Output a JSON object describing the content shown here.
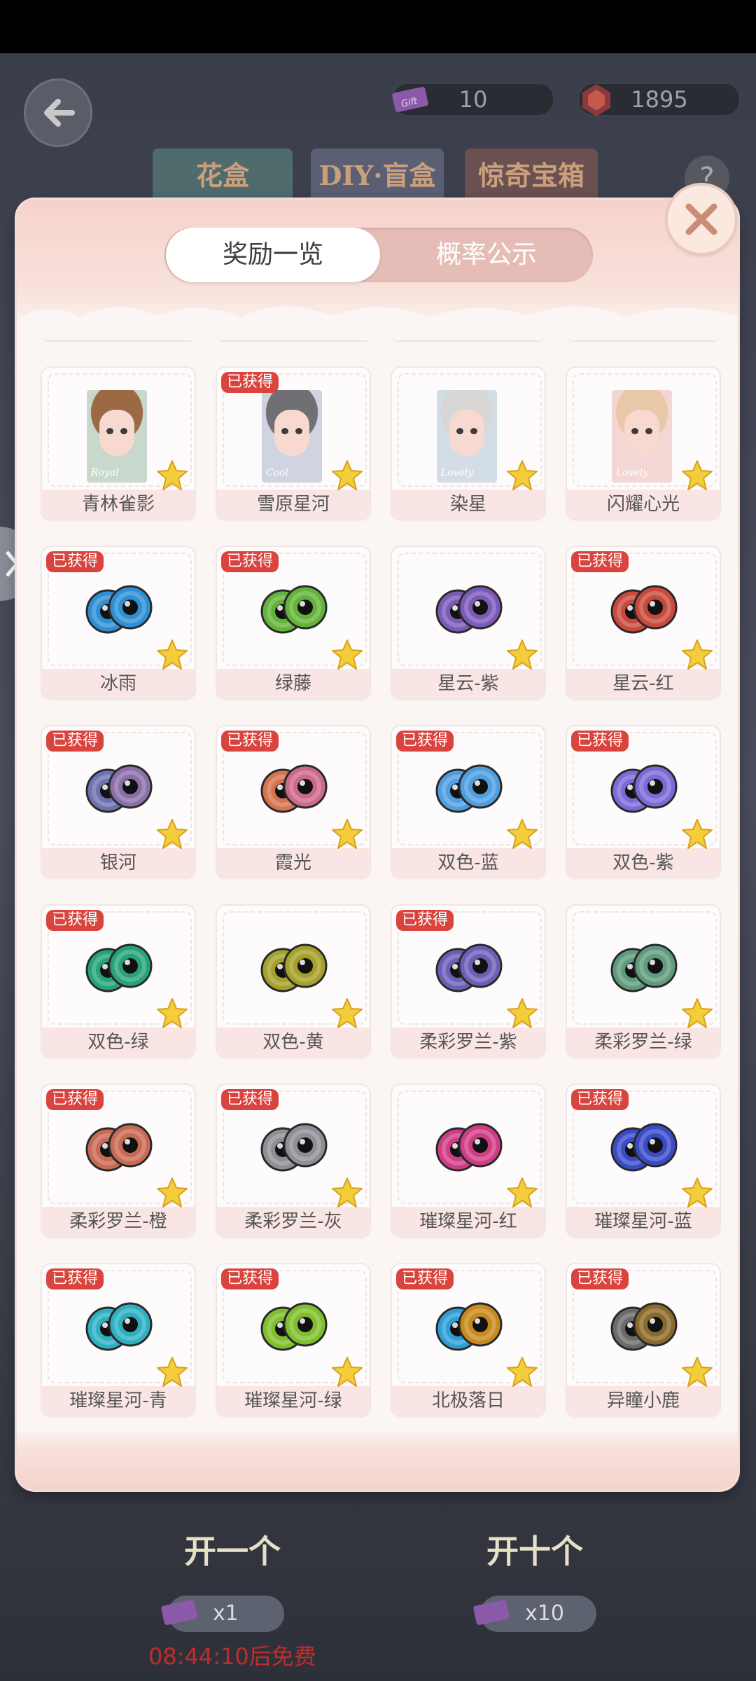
{
  "hud": {
    "ticket_count": "10",
    "gem_count": "1895",
    "top_tabs": [
      "花盒",
      "DIY·盲盒",
      "惊奇宝箱"
    ],
    "help": "?"
  },
  "modal": {
    "tabs": [
      {
        "label": "奖励一览",
        "active": true
      },
      {
        "label": "概率公示",
        "active": false
      }
    ],
    "items": [
      {
        "name": "青林雀影",
        "type": "portrait",
        "caption": "Royal",
        "obtained": false,
        "hair": "#9b6a45",
        "bg": "#c9d8cc"
      },
      {
        "name": "雪原星河",
        "type": "portrait",
        "caption": "Cool",
        "obtained": true,
        "hair": "#6f6f74",
        "bg": "#cfd4e0"
      },
      {
        "name": "染星",
        "type": "portrait",
        "caption": "Lovely",
        "obtained": false,
        "hair": "#d9d6d6",
        "bg": "#d3dde6"
      },
      {
        "name": "闪耀心光",
        "type": "portrait",
        "caption": "Lovely",
        "obtained": false,
        "hair": "#e8c8a8",
        "bg": "#f2d7d4"
      },
      {
        "name": "冰雨",
        "type": "eyes",
        "color": "#2e8fd4",
        "color2": "#2e8fd4",
        "obtained": true
      },
      {
        "name": "绿藤",
        "type": "eyes",
        "color": "#63b43a",
        "color2": "#63b43a",
        "obtained": true
      },
      {
        "name": "星云-紫",
        "type": "eyes",
        "color": "#7a5ab8",
        "color2": "#7a5ab8",
        "obtained": false
      },
      {
        "name": "星云-红",
        "type": "eyes",
        "color": "#c84a3c",
        "color2": "#c84a3c",
        "obtained": true
      },
      {
        "name": "银河",
        "type": "eyes",
        "color": "#6d72b0",
        "color2": "#8a6fa8",
        "obtained": true
      },
      {
        "name": "霞光",
        "type": "eyes",
        "color": "#d6744e",
        "color2": "#cc6a8a",
        "obtained": true
      },
      {
        "name": "双色-蓝",
        "type": "eyes",
        "color": "#4f9ee0",
        "color2": "#4f9ee0",
        "obtained": true
      },
      {
        "name": "双色-紫",
        "type": "eyes",
        "color": "#7d6ad8",
        "color2": "#7d6ad8",
        "obtained": true
      },
      {
        "name": "双色-绿",
        "type": "eyes",
        "color": "#27a37b",
        "color2": "#27a37b",
        "obtained": true
      },
      {
        "name": "双色-黄",
        "type": "eyes",
        "color": "#a5a12a",
        "color2": "#a5a12a",
        "obtained": false
      },
      {
        "name": "柔彩罗兰-紫",
        "type": "eyes",
        "color": "#6a5fb6",
        "color2": "#6a5fb6",
        "obtained": true
      },
      {
        "name": "柔彩罗兰-绿",
        "type": "eyes",
        "color": "#5f9c7e",
        "color2": "#5f9c7e",
        "obtained": false
      },
      {
        "name": "柔彩罗兰-橙",
        "type": "eyes",
        "color": "#c96a55",
        "color2": "#c96a55",
        "obtained": true
      },
      {
        "name": "柔彩罗兰-灰",
        "type": "eyes",
        "color": "#8e9096",
        "color2": "#8e9096",
        "obtained": true
      },
      {
        "name": "璀璨星河-红",
        "type": "eyes",
        "color": "#cf3d86",
        "color2": "#cf3d86",
        "obtained": false
      },
      {
        "name": "璀璨星河-蓝",
        "type": "eyes",
        "color": "#3a4bc8",
        "color2": "#3a4bc8",
        "obtained": true
      },
      {
        "name": "璀璨星河-青",
        "type": "eyes",
        "color": "#2eb0c2",
        "color2": "#2eb0c2",
        "obtained": true
      },
      {
        "name": "璀璨星河-绿",
        "type": "eyes",
        "color": "#7fbf2e",
        "color2": "#7fbf2e",
        "obtained": true
      },
      {
        "name": "北极落日",
        "type": "eyes",
        "color": "#2f9ed6",
        "color2": "#c78a1e",
        "obtained": true
      },
      {
        "name": "异瞳小鹿",
        "type": "eyes",
        "color": "#6b6b6b",
        "color2": "#8a6a2a",
        "obtained": true
      }
    ],
    "obtained_label": "已获得"
  },
  "bottom": {
    "open_one": "开一个",
    "open_ten": "开十个",
    "cost_one": "x1",
    "cost_ten": "x10",
    "timer": "08:44:10后免费"
  },
  "colors": {
    "badge": "#d9443e",
    "card_label_bg": "#f9e6e4",
    "tab_track": "#e6bdb6"
  }
}
